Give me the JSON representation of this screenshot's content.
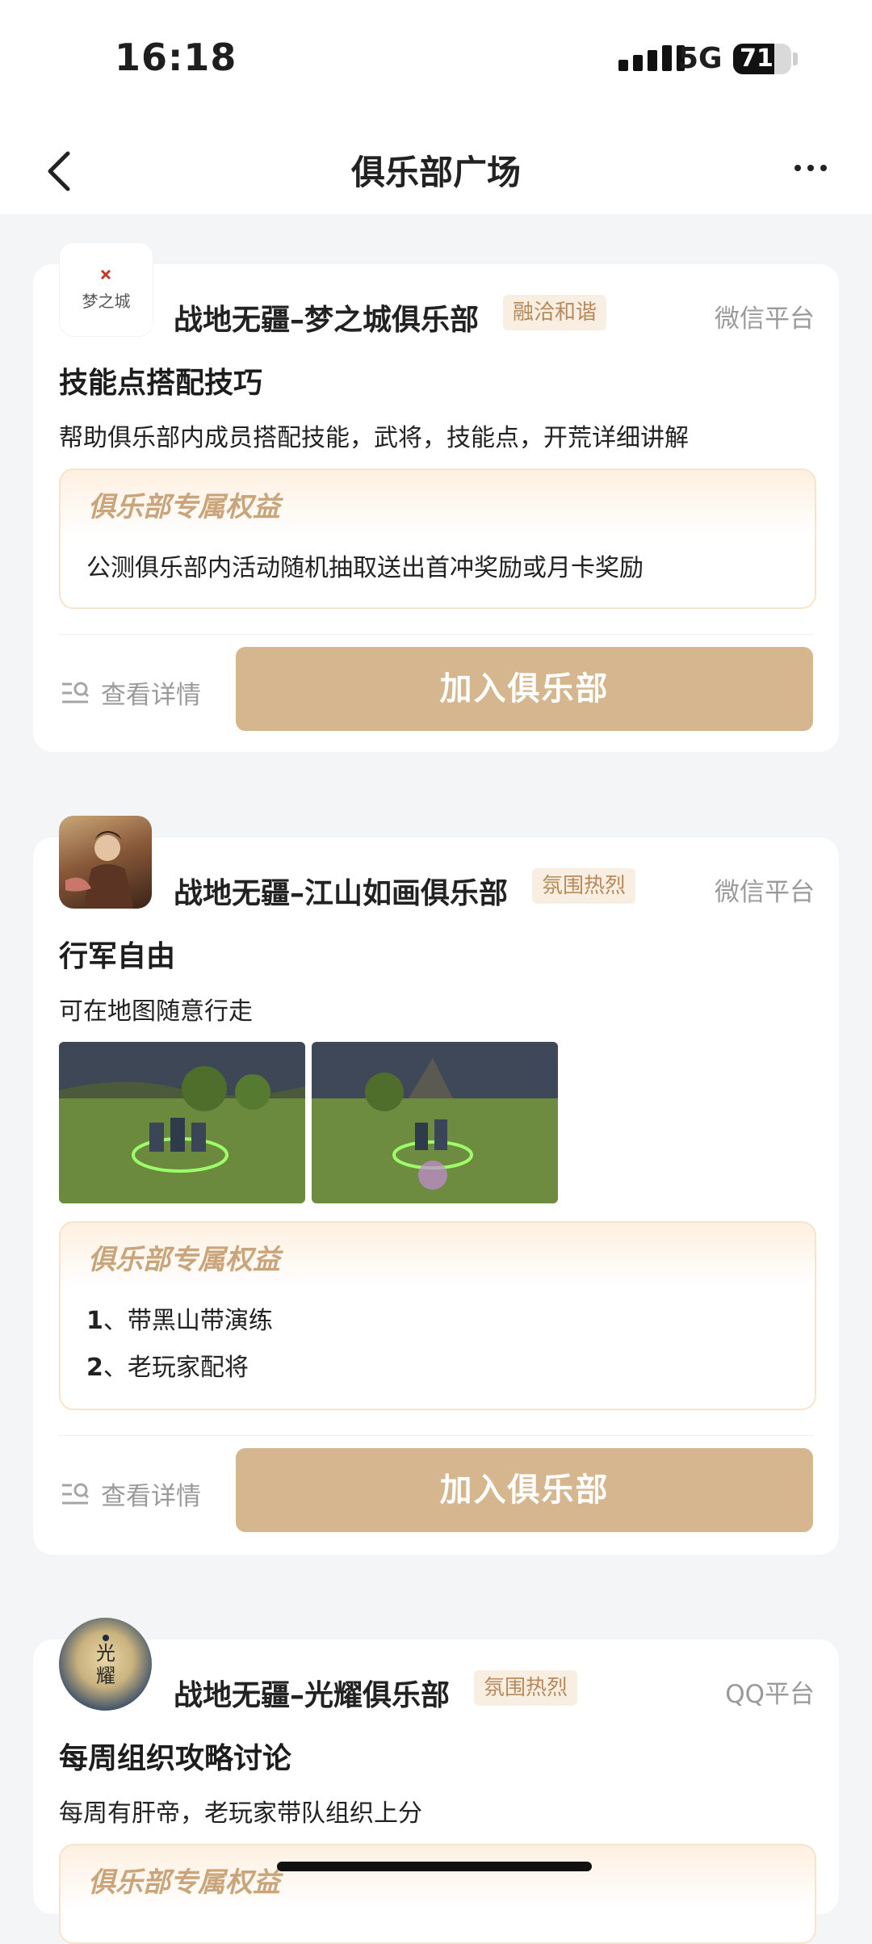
{
  "status_bar": {
    "time": "16:18",
    "network": "5G",
    "battery": "71",
    "battery_level": 0.71
  },
  "nav": {
    "title": "俱乐部广场"
  },
  "clubs": [
    {
      "avatar_text": "梦之城",
      "name": "战地无疆–梦之城俱乐部",
      "tag": "融洽和谐",
      "platform": "微信平台",
      "title": "技能点搭配技巧",
      "desc": "帮助俱乐部内成员搭配技能，武将，技能点，开荒详细讲解",
      "benefit_title": "俱乐部专属权益",
      "benefits": [
        "公测俱乐部内活动随机抽取送出首冲奖励或月卡奖励"
      ],
      "details": "查看详情",
      "join": "加入俱乐部"
    },
    {
      "name": "战地无疆–江山如画俱乐部",
      "tag": "氛围热烈",
      "platform": "微信平台",
      "title": "行军自由",
      "desc": "可在地图随意行走",
      "benefit_title": "俱乐部专属权益",
      "benefits": [
        {
          "num": "1",
          "text": "、带黑山带演练"
        },
        {
          "num": "2",
          "text": "、老玩家配将"
        }
      ],
      "details": "查看详情",
      "join": "加入俱乐部"
    },
    {
      "avatar_text": "光耀",
      "name": "战地无疆–光耀俱乐部",
      "tag": "氛围热烈",
      "platform": "QQ平台",
      "title": "每周组织攻略讨论",
      "desc": "每周有肝帝，老玩家带队组织上分",
      "benefit_title": "俱乐部专属权益"
    }
  ],
  "colors": {
    "accent": "#d5b68e",
    "tag_text": "#b7895b",
    "tag_bg": "#f8efe2",
    "benefit_title": "#caa47a"
  }
}
